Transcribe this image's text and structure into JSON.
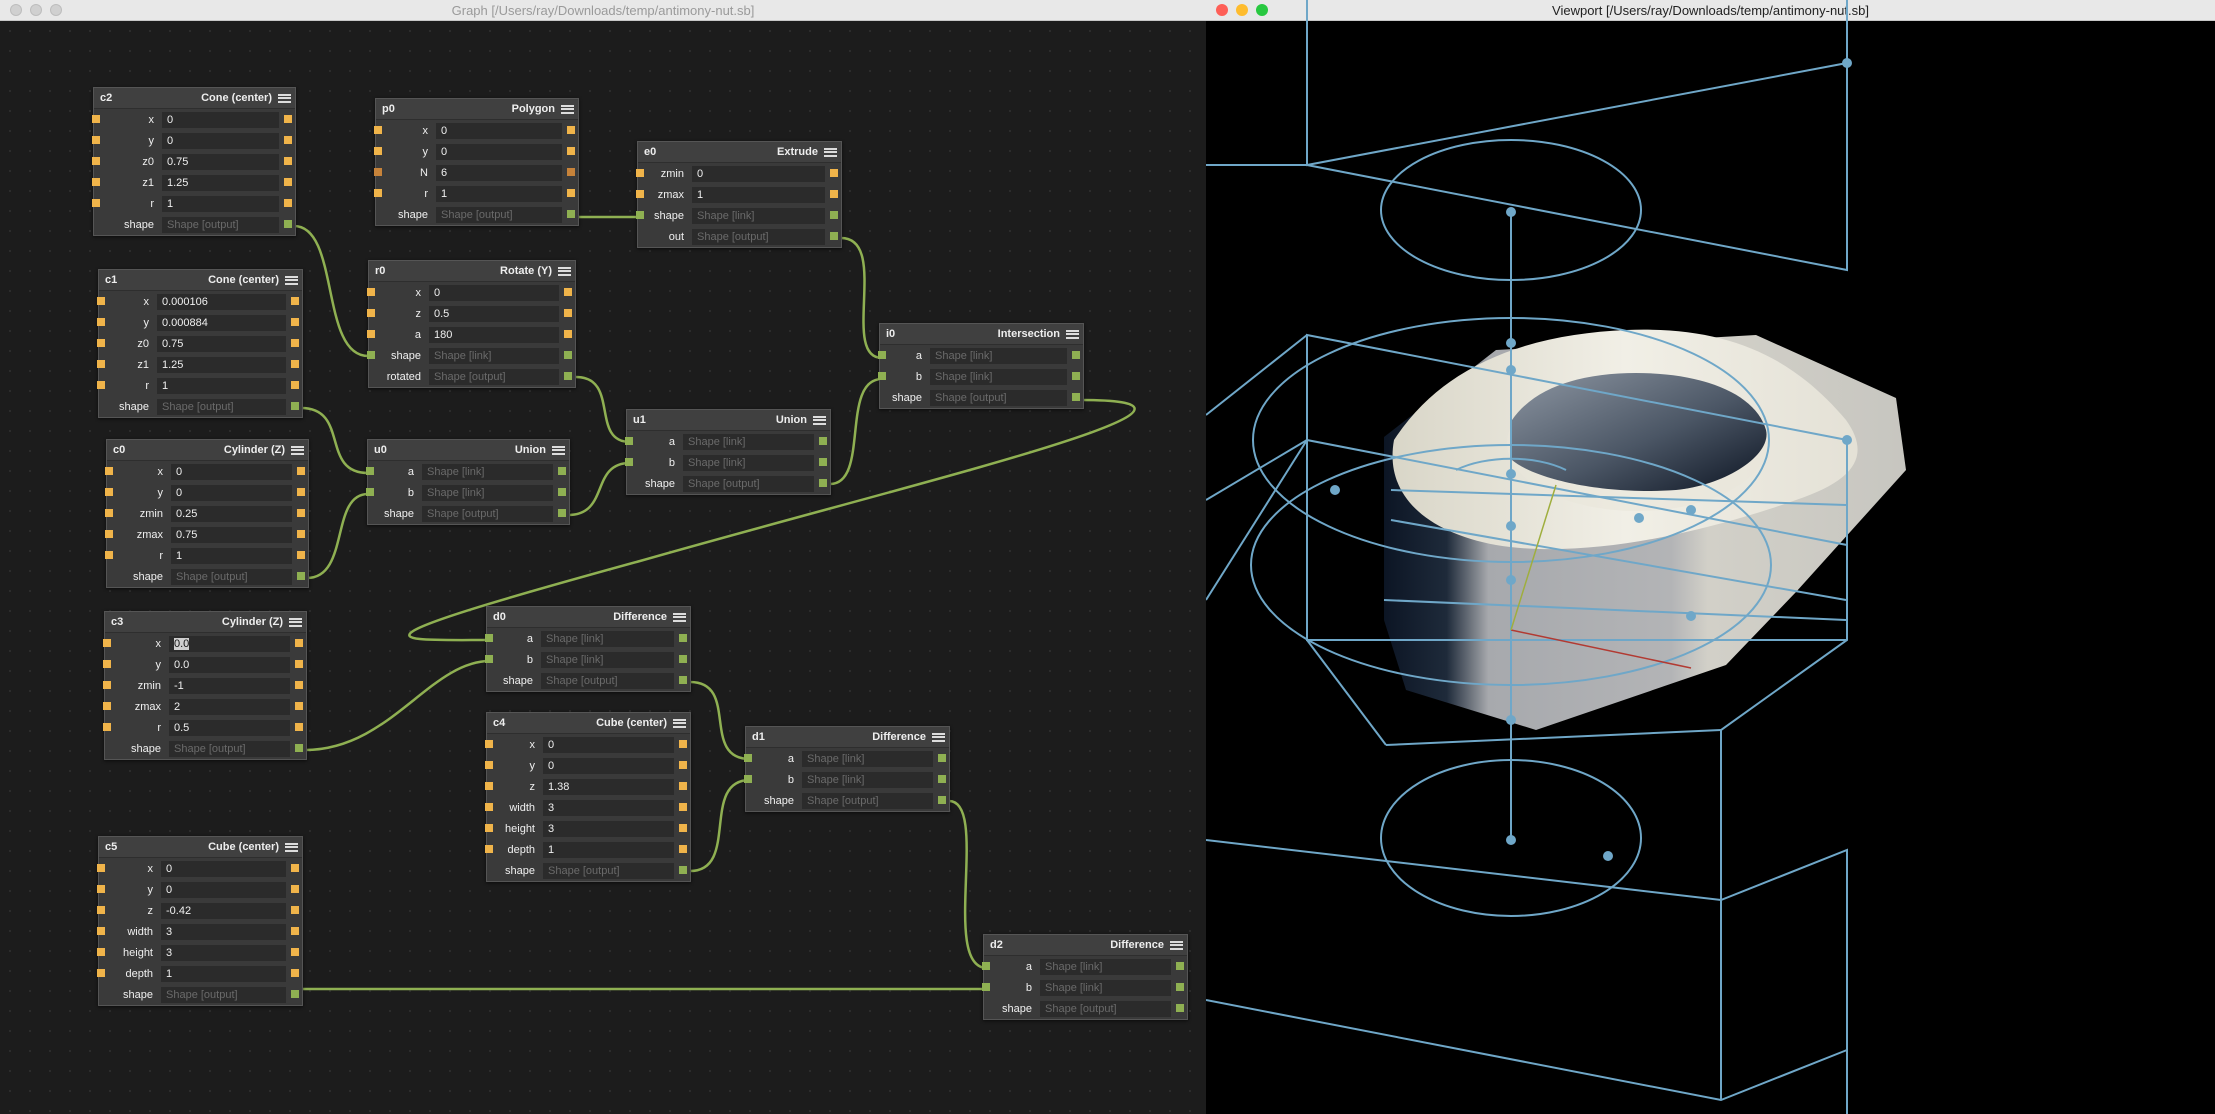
{
  "graph_window": {
    "title": "Graph [/Users/ray/Downloads/temp/antimony-nut.sb]"
  },
  "viewport_window": {
    "title": "Viewport [/Users/ray/Downloads/temp/antimony-nut.sb]"
  },
  "colors": {
    "wire": "#8fb052",
    "input_pin": "#f0b44a",
    "shape_pin": "#8fb052",
    "wireframe": "#6fa7c8",
    "axis_x": "#b23a32",
    "axis_z": "#9fae3e"
  },
  "nodes": {
    "c2": {
      "name": "c2",
      "type": "Cone (center)",
      "rows": [
        {
          "label": "x",
          "value": "0"
        },
        {
          "label": "y",
          "value": "0"
        },
        {
          "label": "z0",
          "value": "0.75"
        },
        {
          "label": "z1",
          "value": "1.25"
        },
        {
          "label": "r",
          "value": "1"
        },
        {
          "label": "shape",
          "value": "Shape [output]"
        }
      ]
    },
    "p0": {
      "name": "p0",
      "type": "Polygon",
      "rows": [
        {
          "label": "x",
          "value": "0"
        },
        {
          "label": "y",
          "value": "0"
        },
        {
          "label": "N",
          "value": "6"
        },
        {
          "label": "r",
          "value": "1"
        },
        {
          "label": "shape",
          "value": "Shape [output]"
        }
      ]
    },
    "e0": {
      "name": "e0",
      "type": "Extrude",
      "rows": [
        {
          "label": "zmin",
          "value": "0"
        },
        {
          "label": "zmax",
          "value": "1"
        },
        {
          "label": "shape",
          "value": "Shape [link]"
        },
        {
          "label": "out",
          "value": "Shape [output]"
        }
      ]
    },
    "c1": {
      "name": "c1",
      "type": "Cone (center)",
      "rows": [
        {
          "label": "x",
          "value": "0.000106"
        },
        {
          "label": "y",
          "value": "0.000884"
        },
        {
          "label": "z0",
          "value": "0.75"
        },
        {
          "label": "z1",
          "value": "1.25"
        },
        {
          "label": "r",
          "value": "1"
        },
        {
          "label": "shape",
          "value": "Shape [output]"
        }
      ]
    },
    "r0": {
      "name": "r0",
      "type": "Rotate (Y)",
      "rows": [
        {
          "label": "x",
          "value": "0"
        },
        {
          "label": "z",
          "value": "0.5"
        },
        {
          "label": "a",
          "value": "180"
        },
        {
          "label": "shape",
          "value": "Shape [link]"
        },
        {
          "label": "rotated",
          "value": "Shape [output]"
        }
      ]
    },
    "i0": {
      "name": "i0",
      "type": "Intersection",
      "rows": [
        {
          "label": "a",
          "value": "Shape [link]"
        },
        {
          "label": "b",
          "value": "Shape [link]"
        },
        {
          "label": "shape",
          "value": "Shape [output]"
        }
      ]
    },
    "u1": {
      "name": "u1",
      "type": "Union",
      "rows": [
        {
          "label": "a",
          "value": "Shape [link]"
        },
        {
          "label": "b",
          "value": "Shape [link]"
        },
        {
          "label": "shape",
          "value": "Shape [output]"
        }
      ]
    },
    "c0": {
      "name": "c0",
      "type": "Cylinder (Z)",
      "rows": [
        {
          "label": "x",
          "value": "0"
        },
        {
          "label": "y",
          "value": "0"
        },
        {
          "label": "zmin",
          "value": "0.25"
        },
        {
          "label": "zmax",
          "value": "0.75"
        },
        {
          "label": "r",
          "value": "1"
        },
        {
          "label": "shape",
          "value": "Shape [output]"
        }
      ]
    },
    "u0": {
      "name": "u0",
      "type": "Union",
      "rows": [
        {
          "label": "a",
          "value": "Shape [link]"
        },
        {
          "label": "b",
          "value": "Shape [link]"
        },
        {
          "label": "shape",
          "value": "Shape [output]"
        }
      ]
    },
    "c3": {
      "name": "c3",
      "type": "Cylinder (Z)",
      "rows": [
        {
          "label": "x",
          "value": "0.0"
        },
        {
          "label": "y",
          "value": "0.0"
        },
        {
          "label": "zmin",
          "value": "-1"
        },
        {
          "label": "zmax",
          "value": "2"
        },
        {
          "label": "r",
          "value": "0.5"
        },
        {
          "label": "shape",
          "value": "Shape [output]"
        }
      ]
    },
    "d0": {
      "name": "d0",
      "type": "Difference",
      "rows": [
        {
          "label": "a",
          "value": "Shape [link]"
        },
        {
          "label": "b",
          "value": "Shape [link]"
        },
        {
          "label": "shape",
          "value": "Shape [output]"
        }
      ]
    },
    "c4": {
      "name": "c4",
      "type": "Cube (center)",
      "rows": [
        {
          "label": "x",
          "value": "0"
        },
        {
          "label": "y",
          "value": "0"
        },
        {
          "label": "z",
          "value": "1.38"
        },
        {
          "label": "width",
          "value": "3"
        },
        {
          "label": "height",
          "value": "3"
        },
        {
          "label": "depth",
          "value": "1"
        },
        {
          "label": "shape",
          "value": "Shape [output]"
        }
      ]
    },
    "d1": {
      "name": "d1",
      "type": "Difference",
      "rows": [
        {
          "label": "a",
          "value": "Shape [link]"
        },
        {
          "label": "b",
          "value": "Shape [link]"
        },
        {
          "label": "shape",
          "value": "Shape [output]"
        }
      ]
    },
    "c5": {
      "name": "c5",
      "type": "Cube (center)",
      "rows": [
        {
          "label": "x",
          "value": "0"
        },
        {
          "label": "y",
          "value": "0"
        },
        {
          "label": "z",
          "value": "-0.42"
        },
        {
          "label": "width",
          "value": "3"
        },
        {
          "label": "height",
          "value": "3"
        },
        {
          "label": "depth",
          "value": "1"
        },
        {
          "label": "shape",
          "value": "Shape [output]"
        }
      ]
    },
    "d2": {
      "name": "d2",
      "type": "Difference",
      "rows": [
        {
          "label": "a",
          "value": "Shape [link]"
        },
        {
          "label": "b",
          "value": "Shape [link]"
        },
        {
          "label": "shape",
          "value": "Shape [output]"
        }
      ]
    }
  }
}
